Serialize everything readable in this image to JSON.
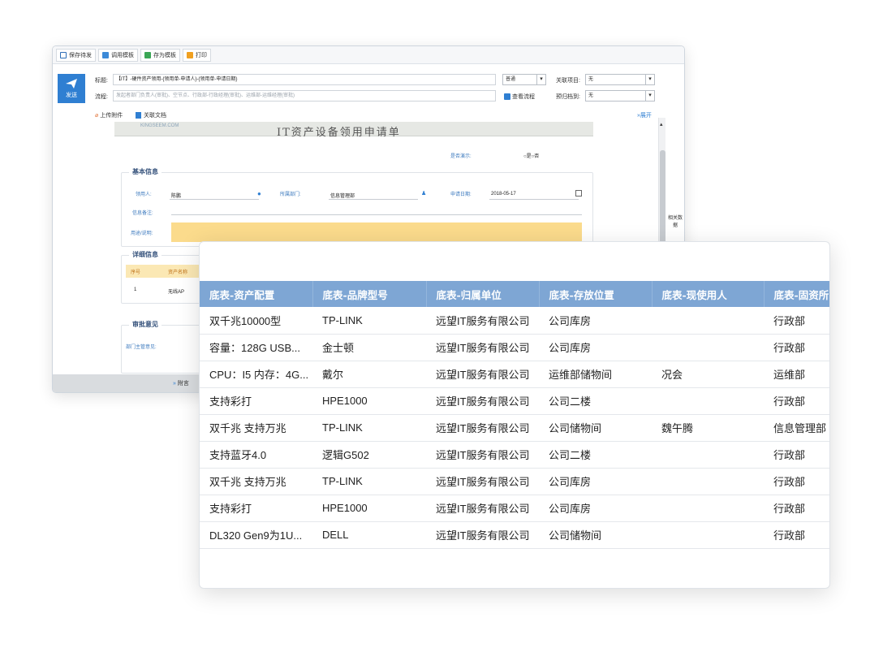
{
  "toolbar": {
    "buttons": [
      {
        "label": "保存待发",
        "icon": "save-icon"
      },
      {
        "label": "调用模板",
        "icon": "template-icon"
      },
      {
        "label": "存为模板",
        "icon": "save-template-icon"
      },
      {
        "label": "打印",
        "icon": "print-icon"
      }
    ]
  },
  "send_label": "发送",
  "fields": {
    "title_label": "标题:",
    "title_value": "【IT】-硬件资产领用-{领用单-申请人}-{领用单-申请日期}",
    "flow_label": "流程:",
    "flow_value": "发起者部门负责人(审批)、空节点、行政部-行政经理(审批)、运维部-运维经理(审批)",
    "priority_value": "普通",
    "related_project_label": "关联项目:",
    "related_project_value": "无",
    "archive_label": "预归档到:",
    "archive_value": "无",
    "view_flow_label": "查看流程",
    "attach_label": "上传附件",
    "related_doc_label": "关联文档",
    "expand_label": "展开"
  },
  "form": {
    "logo_text": "KINGSEEM.COM",
    "title": "IT资产设备领用申请单",
    "demo_label": "是否演示:",
    "demo_options": "○是○否",
    "basic_section": "基本信息",
    "user_label": "领用人:",
    "user_value": "陈鹏",
    "dept_label": "所属部门:",
    "dept_value": "信息管理部",
    "date_label": "申请日期:",
    "date_value": "2018-05-17",
    "note_label": "信息备注:",
    "purpose_label": "用途/说明:",
    "detail_section": "详细信息",
    "col_no": "序号",
    "col_asset": "资产名称",
    "row_no": "1",
    "row_asset": "无线AP",
    "approval_section": "审批意见",
    "dept_head_label": "部门主管意见:",
    "attach_footer": "附言"
  },
  "side_tab_label": "相关数据",
  "table": {
    "headers": [
      "底表-资产配置",
      "底表-品牌型号",
      "底表-归属单位",
      "底表-存放位置",
      "底表-现使用人",
      "底表-固资所"
    ],
    "rows": [
      [
        "双千兆10000型",
        "TP-LINK",
        "远望IT服务有限公司",
        "公司库房",
        "",
        "行政部"
      ],
      [
        "容量：128G USB...",
        "金士顿",
        "远望IT服务有限公司",
        "公司库房",
        "",
        "行政部"
      ],
      [
        "CPU：I5 内存：4G...",
        "戴尔",
        "远望IT服务有限公司",
        "运维部储物间",
        "况会",
        "运维部"
      ],
      [
        "支持彩打",
        "HPE1000",
        "远望IT服务有限公司",
        "公司二楼",
        "",
        "行政部"
      ],
      [
        "双千兆 支持万兆",
        "TP-LINK",
        "远望IT服务有限公司",
        "公司储物间",
        "魏午腾",
        "信息管理部"
      ],
      [
        "支持蓝牙4.0",
        "逻辑G502",
        "远望IT服务有限公司",
        "公司二楼",
        "",
        "行政部"
      ],
      [
        "双千兆 支持万兆",
        "TP-LINK",
        "远望IT服务有限公司",
        "公司库房",
        "",
        "行政部"
      ],
      [
        "支持彩打",
        "HPE1000",
        "远望IT服务有限公司",
        "公司库房",
        "",
        "行政部"
      ],
      [
        "DL320 Gen9为1U...",
        "DELL",
        "远望IT服务有限公司",
        "公司储物间",
        "",
        "行政部"
      ]
    ]
  },
  "colors": {
    "header_bg": "#7ea6d4",
    "send_button": "#2f7fd2",
    "section_title": "#33507a",
    "field_label": "#3e7bbf",
    "highlight_field": "#fbdb8c"
  }
}
